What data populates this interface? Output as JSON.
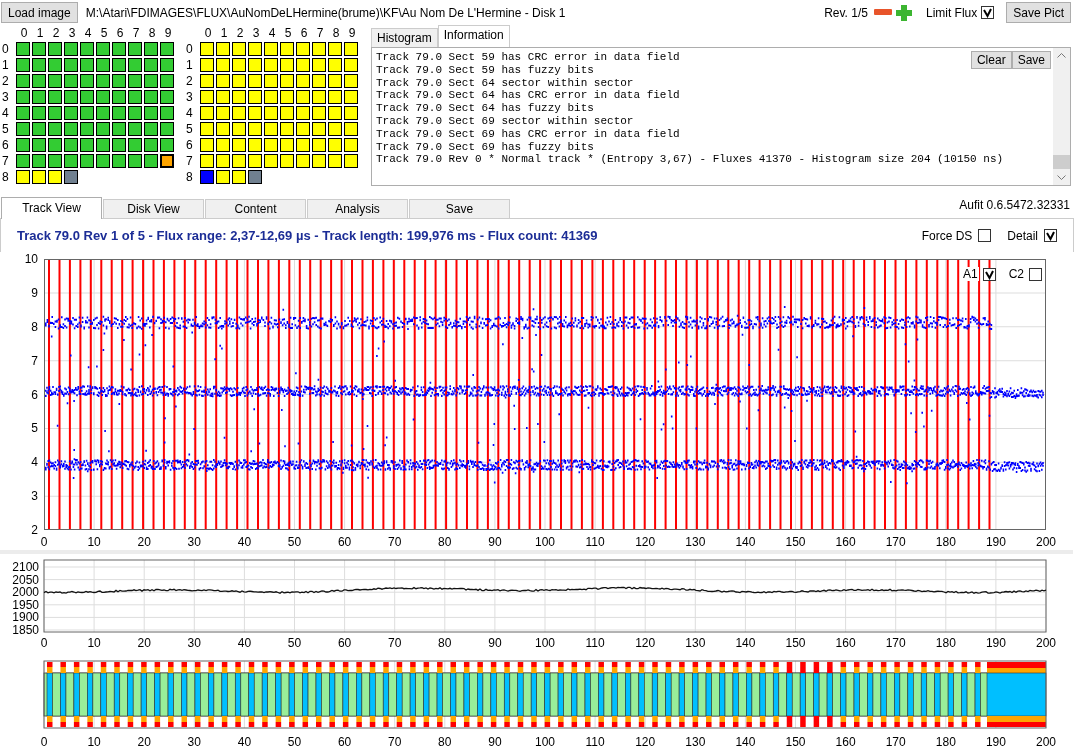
{
  "toolbar": {
    "load_button": "Load image",
    "path": "M:\\Atari\\FDIMAGES\\FLUX\\AuNomDeLHermine(brume)\\KF\\Au Nom De L'Hermine - Disk 1",
    "revision": "Rev. 1/5",
    "limit_flux": {
      "label": "Limit Flux",
      "checked": true
    },
    "save_button": "Save Pict"
  },
  "grids": [
    {
      "column_labels": [
        "0",
        "1",
        "2",
        "3",
        "4",
        "5",
        "6",
        "7",
        "8",
        "9"
      ],
      "rows": [
        {
          "label": "0",
          "cells": [
            {
              "color": "#33cc33",
              "selected": false
            },
            {
              "color": "#33cc33",
              "selected": false
            },
            {
              "color": "#33cc33",
              "selected": false
            },
            {
              "color": "#33cc33",
              "selected": false
            },
            {
              "color": "#33cc33",
              "selected": false
            },
            {
              "color": "#33cc33",
              "selected": false
            },
            {
              "color": "#33cc33",
              "selected": false
            },
            {
              "color": "#33cc33",
              "selected": false
            },
            {
              "color": "#33cc33",
              "selected": false
            },
            {
              "color": "#33cc33",
              "selected": false
            }
          ]
        },
        {
          "label": "1",
          "cells": [
            {
              "color": "#33cc33",
              "selected": false
            },
            {
              "color": "#33cc33",
              "selected": false
            },
            {
              "color": "#33cc33",
              "selected": false
            },
            {
              "color": "#33cc33",
              "selected": false
            },
            {
              "color": "#33cc33",
              "selected": false
            },
            {
              "color": "#33cc33",
              "selected": false
            },
            {
              "color": "#33cc33",
              "selected": false
            },
            {
              "color": "#33cc33",
              "selected": false
            },
            {
              "color": "#33cc33",
              "selected": false
            },
            {
              "color": "#33cc33",
              "selected": false
            }
          ]
        },
        {
          "label": "2",
          "cells": [
            {
              "color": "#33cc33",
              "selected": false
            },
            {
              "color": "#33cc33",
              "selected": false
            },
            {
              "color": "#33cc33",
              "selected": false
            },
            {
              "color": "#33cc33",
              "selected": false
            },
            {
              "color": "#33cc33",
              "selected": false
            },
            {
              "color": "#33cc33",
              "selected": false
            },
            {
              "color": "#33cc33",
              "selected": false
            },
            {
              "color": "#33cc33",
              "selected": false
            },
            {
              "color": "#33cc33",
              "selected": false
            },
            {
              "color": "#33cc33",
              "selected": false
            }
          ]
        },
        {
          "label": "3",
          "cells": [
            {
              "color": "#33cc33",
              "selected": false
            },
            {
              "color": "#33cc33",
              "selected": false
            },
            {
              "color": "#33cc33",
              "selected": false
            },
            {
              "color": "#33cc33",
              "selected": false
            },
            {
              "color": "#33cc33",
              "selected": false
            },
            {
              "color": "#33cc33",
              "selected": false
            },
            {
              "color": "#33cc33",
              "selected": false
            },
            {
              "color": "#33cc33",
              "selected": false
            },
            {
              "color": "#33cc33",
              "selected": false
            },
            {
              "color": "#33cc33",
              "selected": false
            }
          ]
        },
        {
          "label": "4",
          "cells": [
            {
              "color": "#33cc33",
              "selected": false
            },
            {
              "color": "#33cc33",
              "selected": false
            },
            {
              "color": "#33cc33",
              "selected": false
            },
            {
              "color": "#33cc33",
              "selected": false
            },
            {
              "color": "#33cc33",
              "selected": false
            },
            {
              "color": "#33cc33",
              "selected": false
            },
            {
              "color": "#33cc33",
              "selected": false
            },
            {
              "color": "#33cc33",
              "selected": false
            },
            {
              "color": "#33cc33",
              "selected": false
            },
            {
              "color": "#33cc33",
              "selected": false
            }
          ]
        },
        {
          "label": "5",
          "cells": [
            {
              "color": "#33cc33",
              "selected": false
            },
            {
              "color": "#33cc33",
              "selected": false
            },
            {
              "color": "#33cc33",
              "selected": false
            },
            {
              "color": "#33cc33",
              "selected": false
            },
            {
              "color": "#33cc33",
              "selected": false
            },
            {
              "color": "#33cc33",
              "selected": false
            },
            {
              "color": "#33cc33",
              "selected": false
            },
            {
              "color": "#33cc33",
              "selected": false
            },
            {
              "color": "#33cc33",
              "selected": false
            },
            {
              "color": "#33cc33",
              "selected": false
            }
          ]
        },
        {
          "label": "6",
          "cells": [
            {
              "color": "#33cc33",
              "selected": false
            },
            {
              "color": "#33cc33",
              "selected": false
            },
            {
              "color": "#33cc33",
              "selected": false
            },
            {
              "color": "#33cc33",
              "selected": false
            },
            {
              "color": "#33cc33",
              "selected": false
            },
            {
              "color": "#33cc33",
              "selected": false
            },
            {
              "color": "#33cc33",
              "selected": false
            },
            {
              "color": "#33cc33",
              "selected": false
            },
            {
              "color": "#33cc33",
              "selected": false
            },
            {
              "color": "#33cc33",
              "selected": false
            }
          ]
        },
        {
          "label": "7",
          "cells": [
            {
              "color": "#33cc33",
              "selected": false
            },
            {
              "color": "#33cc33",
              "selected": false
            },
            {
              "color": "#33cc33",
              "selected": false
            },
            {
              "color": "#33cc33",
              "selected": false
            },
            {
              "color": "#33cc33",
              "selected": false
            },
            {
              "color": "#33cc33",
              "selected": false
            },
            {
              "color": "#33cc33",
              "selected": false
            },
            {
              "color": "#33cc33",
              "selected": false
            },
            {
              "color": "#33cc33",
              "selected": false
            },
            {
              "color": "#ffa500",
              "selected": true
            }
          ]
        },
        {
          "label": "8",
          "cells": [
            {
              "color": "#ffff00",
              "selected": false
            },
            {
              "color": "#ffff00",
              "selected": false
            },
            {
              "color": "#ffff00",
              "selected": false
            },
            {
              "color": "#708090",
              "selected": false
            }
          ]
        }
      ]
    },
    {
      "column_labels": [
        "0",
        "1",
        "2",
        "3",
        "4",
        "5",
        "6",
        "7",
        "8",
        "9"
      ],
      "rows": [
        {
          "label": "0",
          "cells": [
            {
              "color": "#ffff00",
              "selected": false
            },
            {
              "color": "#ffff00",
              "selected": false
            },
            {
              "color": "#ffff00",
              "selected": false
            },
            {
              "color": "#ffff00",
              "selected": false
            },
            {
              "color": "#ffff00",
              "selected": false
            },
            {
              "color": "#ffff00",
              "selected": false
            },
            {
              "color": "#ffff00",
              "selected": false
            },
            {
              "color": "#ffff00",
              "selected": false
            },
            {
              "color": "#ffff00",
              "selected": false
            },
            {
              "color": "#ffff00",
              "selected": false
            }
          ]
        },
        {
          "label": "1",
          "cells": [
            {
              "color": "#ffff00",
              "selected": false
            },
            {
              "color": "#ffff00",
              "selected": false
            },
            {
              "color": "#ffff00",
              "selected": false
            },
            {
              "color": "#ffff00",
              "selected": false
            },
            {
              "color": "#ffff00",
              "selected": false
            },
            {
              "color": "#ffff00",
              "selected": false
            },
            {
              "color": "#ffff00",
              "selected": false
            },
            {
              "color": "#ffff00",
              "selected": false
            },
            {
              "color": "#ffff00",
              "selected": false
            },
            {
              "color": "#ffff00",
              "selected": false
            }
          ]
        },
        {
          "label": "2",
          "cells": [
            {
              "color": "#ffff00",
              "selected": false
            },
            {
              "color": "#ffff00",
              "selected": false
            },
            {
              "color": "#ffff00",
              "selected": false
            },
            {
              "color": "#ffff00",
              "selected": false
            },
            {
              "color": "#ffff00",
              "selected": false
            },
            {
              "color": "#ffff00",
              "selected": false
            },
            {
              "color": "#ffff00",
              "selected": false
            },
            {
              "color": "#ffff00",
              "selected": false
            },
            {
              "color": "#ffff00",
              "selected": false
            },
            {
              "color": "#ffff00",
              "selected": false
            }
          ]
        },
        {
          "label": "3",
          "cells": [
            {
              "color": "#ffff00",
              "selected": false
            },
            {
              "color": "#ffff00",
              "selected": false
            },
            {
              "color": "#ffff00",
              "selected": false
            },
            {
              "color": "#ffff00",
              "selected": false
            },
            {
              "color": "#ffff00",
              "selected": false
            },
            {
              "color": "#ffff00",
              "selected": false
            },
            {
              "color": "#ffff00",
              "selected": false
            },
            {
              "color": "#ffff00",
              "selected": false
            },
            {
              "color": "#ffff00",
              "selected": false
            },
            {
              "color": "#ffff00",
              "selected": false
            }
          ]
        },
        {
          "label": "4",
          "cells": [
            {
              "color": "#ffff00",
              "selected": false
            },
            {
              "color": "#ffff00",
              "selected": false
            },
            {
              "color": "#ffff00",
              "selected": false
            },
            {
              "color": "#ffff00",
              "selected": false
            },
            {
              "color": "#ffff00",
              "selected": false
            },
            {
              "color": "#ffff00",
              "selected": false
            },
            {
              "color": "#ffff00",
              "selected": false
            },
            {
              "color": "#ffff00",
              "selected": false
            },
            {
              "color": "#ffff00",
              "selected": false
            },
            {
              "color": "#ffff00",
              "selected": false
            }
          ]
        },
        {
          "label": "5",
          "cells": [
            {
              "color": "#ffff00",
              "selected": false
            },
            {
              "color": "#ffff00",
              "selected": false
            },
            {
              "color": "#ffff00",
              "selected": false
            },
            {
              "color": "#ffff00",
              "selected": false
            },
            {
              "color": "#ffff00",
              "selected": false
            },
            {
              "color": "#ffff00",
              "selected": false
            },
            {
              "color": "#ffff00",
              "selected": false
            },
            {
              "color": "#ffff00",
              "selected": false
            },
            {
              "color": "#ffff00",
              "selected": false
            },
            {
              "color": "#ffff00",
              "selected": false
            }
          ]
        },
        {
          "label": "6",
          "cells": [
            {
              "color": "#ffff00",
              "selected": false
            },
            {
              "color": "#ffff00",
              "selected": false
            },
            {
              "color": "#ffff00",
              "selected": false
            },
            {
              "color": "#ffff00",
              "selected": false
            },
            {
              "color": "#ffff00",
              "selected": false
            },
            {
              "color": "#ffff00",
              "selected": false
            },
            {
              "color": "#ffff00",
              "selected": false
            },
            {
              "color": "#ffff00",
              "selected": false
            },
            {
              "color": "#ffff00",
              "selected": false
            },
            {
              "color": "#ffff00",
              "selected": false
            }
          ]
        },
        {
          "label": "7",
          "cells": [
            {
              "color": "#ffff00",
              "selected": false
            },
            {
              "color": "#ffff00",
              "selected": false
            },
            {
              "color": "#ffff00",
              "selected": false
            },
            {
              "color": "#ffff00",
              "selected": false
            },
            {
              "color": "#ffff00",
              "selected": false
            },
            {
              "color": "#ffff00",
              "selected": false
            },
            {
              "color": "#ffff00",
              "selected": false
            },
            {
              "color": "#ffff00",
              "selected": false
            },
            {
              "color": "#ffff00",
              "selected": false
            },
            {
              "color": "#ffff00",
              "selected": false
            }
          ]
        },
        {
          "label": "8",
          "cells": [
            {
              "color": "#0000ff",
              "selected": false
            },
            {
              "color": "#ffff00",
              "selected": false
            },
            {
              "color": "#ffff00",
              "selected": false
            },
            {
              "color": "#708090",
              "selected": false
            }
          ]
        }
      ]
    }
  ],
  "info_panel": {
    "tabs": [
      {
        "label": "Histogram",
        "selected": false
      },
      {
        "label": "Information",
        "selected": true
      }
    ],
    "buttons": [
      "Clear",
      "Save"
    ],
    "lines": [
      "Track 79.0 Sect 59 has CRC error in data field",
      "Track 79.0 Sect 59 has fuzzy bits",
      "Track 79.0 Sect 64 sector within sector",
      "Track 79.0 Sect 64 has CRC error in data field",
      "Track 79.0 Sect 64 has fuzzy bits",
      "Track 79.0 Sect 69 sector within sector",
      "Track 79.0 Sect 69 has CRC error in data field",
      "Track 79.0 Sect 69 has fuzzy bits",
      "Track 79.0 Rev 0 * Normal track * (Entropy 3,67) - Fluxes 41370 - Histogram size 204 (10150 ns)"
    ]
  },
  "main_tabs": [
    {
      "label": "Track View",
      "selected": true
    },
    {
      "label": "Disk View",
      "selected": false
    },
    {
      "label": "Content",
      "selected": false
    },
    {
      "label": "Analysis",
      "selected": false
    },
    {
      "label": "Save",
      "selected": false
    }
  ],
  "version": "Aufit 0.6.5472.32331",
  "track_summary": "Track 79.0 Rev 1 of 5 - Flux range: 2,37-12,69 µs - Track length: 199,976 ms - Flux count: 41369",
  "options": [
    {
      "label": "Force DS",
      "checked": false
    },
    {
      "label": "Detail",
      "checked": true
    }
  ],
  "flux_plot": {
    "y_labels": [
      "10",
      "9",
      "8",
      "7",
      "6",
      "5",
      "4",
      "3",
      "2"
    ],
    "x_labels": [
      "0",
      "10",
      "20",
      "30",
      "40",
      "50",
      "60",
      "70",
      "80",
      "90",
      "100",
      "110",
      "120",
      "130",
      "140",
      "150",
      "160",
      "170",
      "180",
      "190",
      "200"
    ],
    "channels": [
      {
        "label": "A1",
        "checked": true
      },
      {
        "label": "C2",
        "checked": false
      }
    ]
  },
  "timing_plot": {
    "y_labels": [
      "2100",
      "2050",
      "2000",
      "1950",
      "1900",
      "1850"
    ],
    "x_labels": [
      "0",
      "10",
      "20",
      "30",
      "40",
      "50",
      "60",
      "70",
      "80",
      "90",
      "100",
      "110",
      "120",
      "130",
      "140",
      "150",
      "160",
      "170",
      "180",
      "190",
      "200"
    ]
  },
  "sector_map": {
    "x_labels": [
      "0",
      "10",
      "20",
      "30",
      "40",
      "50",
      "60",
      "70",
      "80",
      "90",
      "100",
      "110",
      "120",
      "130",
      "140",
      "150",
      "160",
      "170",
      "180",
      "190",
      "200"
    ]
  }
}
